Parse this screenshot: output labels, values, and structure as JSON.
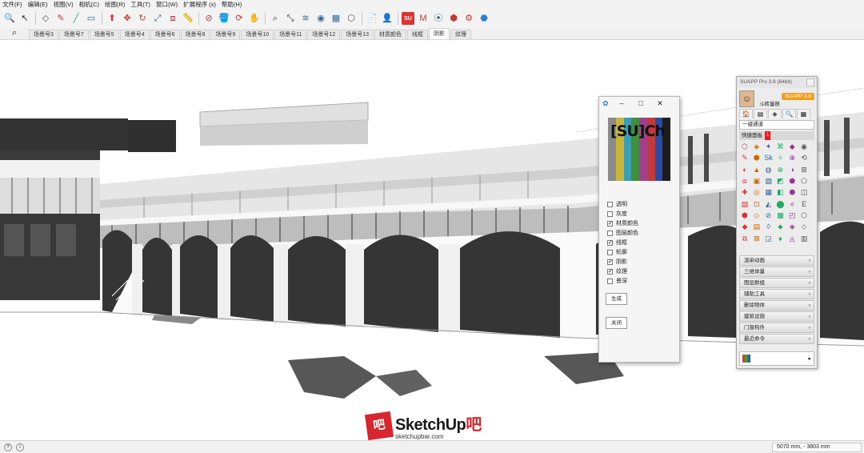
{
  "menubar": {
    "items": [
      "文件(F)",
      "编辑(E)",
      "视图(V)",
      "相机(C)",
      "绘图(R)",
      "工具(T)",
      "窗口(W)",
      "扩展程序 (x)",
      "帮助(H)"
    ]
  },
  "toolbar": {
    "icons": [
      "zoom-icon",
      "select-icon",
      "eraser-icon",
      "pencil-icon",
      "line-icon",
      "rectangle-icon",
      "push-pull-icon",
      "move-icon",
      "rotate-icon",
      "scale-icon",
      "offset-icon",
      "tape-icon",
      "section-icon",
      "paint-icon",
      "orbit-icon",
      "pan-icon",
      "zoom-window-icon",
      "zoom-extents-icon",
      "layers-icon",
      "styles-icon",
      "scenes-icon",
      "components-icon",
      "new-file-icon",
      "user-icon",
      "suapp-icon",
      "material-icon",
      "camera-icon",
      "solid-icon",
      "plugin-icon",
      "extension-icon"
    ],
    "glyphs": [
      "🔍",
      "↖",
      "◇",
      "✎",
      "╱",
      "▭",
      "⬆",
      "✥",
      "↻",
      "⤢",
      "⧈",
      "📏",
      "⊘",
      "🪣",
      "⟳",
      "✋",
      "⌕",
      "⤡",
      "≋",
      "◉",
      "▦",
      "⬡",
      "📄",
      "👤",
      "SU",
      "M",
      "⦿",
      "⬢",
      "⚙",
      "⬣"
    ]
  },
  "scene_tabs": {
    "search_icon": "search-icon",
    "items": [
      "场景号3",
      "场景号7",
      "场景号5",
      "场景号4",
      "场景号6",
      "场景号8",
      "场景号9",
      "场景号10",
      "场景号11",
      "场景号12",
      "场景号13",
      "材质颜色",
      "线框",
      "阴影",
      "纹理"
    ],
    "active_index": 13
  },
  "dialog": {
    "title_icon": "settings-icon",
    "minimize": "–",
    "maximize": "□",
    "close": "✕",
    "logo_text": "[SU]Ch",
    "logo_colors": [
      "#8a8a8a",
      "#c9b53a",
      "#3a9fb0",
      "#3f8f3c",
      "#a33d8c",
      "#c23a3a",
      "#2a4aa8",
      "#1d1d1d"
    ],
    "options": [
      {
        "label": "透明",
        "checked": false
      },
      {
        "label": "灰度",
        "checked": false
      },
      {
        "label": "材质颜色",
        "checked": true
      },
      {
        "label": "图层颜色",
        "checked": false
      },
      {
        "label": "线框",
        "checked": true
      },
      {
        "label": "轮廓",
        "checked": false
      },
      {
        "label": "阴影",
        "checked": true
      },
      {
        "label": "纹理",
        "checked": true
      },
      {
        "label": "景深",
        "checked": false
      }
    ],
    "generate_label": "生成",
    "close_label": "关闭"
  },
  "suapp": {
    "title": "SUAPP Pro 3.8 (64bit)",
    "username": "斗砖量移",
    "version_badge": "SUAPP 3.8",
    "tabs": [
      "🏠",
      "▤",
      "◈",
      "🔍",
      "▦"
    ],
    "search_value": "一键通道",
    "quick_panel_label": "快捷面板",
    "quick_panel_badge": "1",
    "tool_glyphs": [
      "⬡",
      "◈",
      "✦",
      "⌘",
      "◆",
      "◉",
      "✎",
      "⬢",
      "Sk",
      "✧",
      "⊕",
      "⟲",
      "◐",
      "▲",
      "◍",
      "⊗",
      "◑",
      "⊞",
      "⧈",
      "▣",
      "▨",
      "◩",
      "⬟",
      "⬠",
      "✚",
      "◎",
      "▦",
      "◧",
      "⬣",
      "◫",
      "▧",
      "⊡",
      "◭",
      "⬤",
      "⟡",
      "E",
      "⬢",
      "◇",
      "⊘",
      "▩",
      "◰",
      "⬡",
      "◆",
      "▤",
      "◊",
      "⬥",
      "◈",
      "⬦",
      "⧉",
      "⊠",
      "◲",
      "⬧",
      "◬",
      "▥"
    ],
    "categories": [
      "渲染动画",
      "三维体量",
      "图层群组",
      "辅助工具",
      "删除物体",
      "建筑设施",
      "门窗构件",
      "最近命令"
    ]
  },
  "watermark": {
    "mark": "吧",
    "brand_prefix": "SketchUp",
    "brand_suffix": "吧",
    "url": "sketchupbar.com"
  },
  "status": {
    "icons": [
      "info-icon",
      "geo-icon"
    ],
    "measurement": "5070 mm, - 3803 mm"
  }
}
